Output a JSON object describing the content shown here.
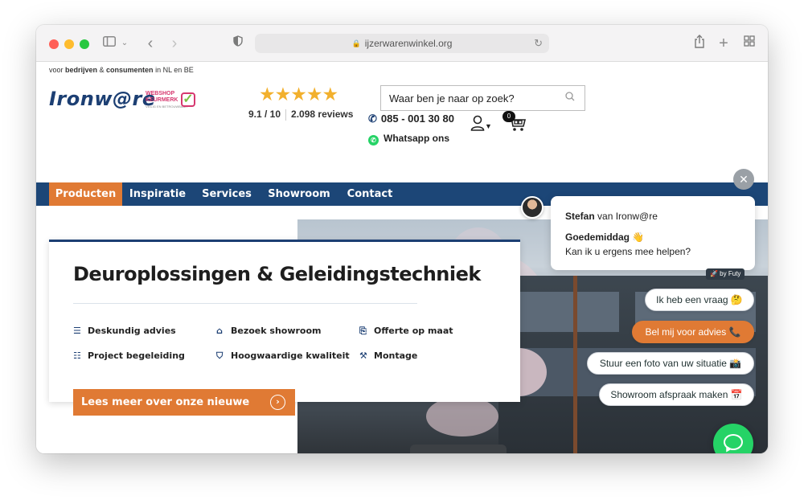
{
  "browser": {
    "url": "ijzerwarenwinkel.org",
    "icons": [
      "sidebar-icon",
      "chevron-down-icon",
      "back-icon",
      "forward-icon",
      "shield-icon",
      "lock-icon",
      "reload-icon",
      "share-icon",
      "new-tab-icon",
      "tabs-overview-icon"
    ]
  },
  "header": {
    "tagline_pre": "voor ",
    "tagline_b1": "bedrijven",
    "tagline_mid": " & ",
    "tagline_b2": "consumenten",
    "tagline_post": " in NL en BE",
    "logo": "Ironw@re",
    "keurmerk_line1": "WEBSHOP",
    "keurmerk_line2": "KEURMERK",
    "keurmerk_sub": "VEILIG EN BETROUWBAAR",
    "stars": "★★★★★",
    "rating_score": "9.1 / 10",
    "rating_reviews": "2.098 reviews",
    "search_placeholder": "Waar ben je naar op zoek?",
    "phone": "085 - 001 30 80",
    "whatsapp": "Whatsapp ons",
    "cart_count": "0"
  },
  "nav": {
    "items": [
      "Producten",
      "Inspiratie",
      "Services",
      "Showroom",
      "Contact"
    ],
    "active": "Producten"
  },
  "hero": {
    "title": "Deuroplossingen & Geleidingstechniek",
    "features": [
      {
        "icon": "list-icon",
        "label": "Deskundig advies"
      },
      {
        "icon": "warehouse-icon",
        "label": "Bezoek showroom"
      },
      {
        "icon": "quote-file-icon",
        "label": "Offerte op maat"
      },
      {
        "icon": "team-icon",
        "label": "Project begeleiding"
      },
      {
        "icon": "shield-check-icon",
        "label": "Hoogwaardige kwaliteit"
      },
      {
        "icon": "wrench-icon",
        "label": "Montage"
      }
    ],
    "cta": "Lees meer over onze nieuwe showroom"
  },
  "chat": {
    "agent_name": "Stefan",
    "agent_suffix": " van Ironw@re",
    "greeting": "Goedemiddag 👋",
    "question": "Kan ik u ergens mee helpen?",
    "brand": "🚀 by Futy",
    "options": [
      "Ik heb een vraag 🤔",
      "Bel mij voor advies 📞",
      "Stuur een foto van uw situatie 📸",
      "Showroom afspraak maken 📅"
    ]
  },
  "colors": {
    "navy": "#1c4677",
    "orange": "#e07a34",
    "whatsapp_green": "#25d366"
  }
}
